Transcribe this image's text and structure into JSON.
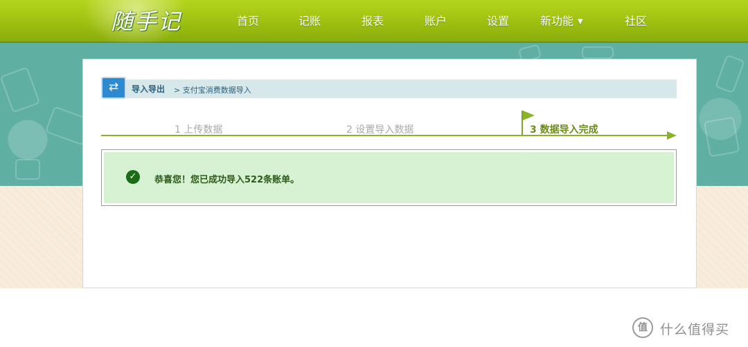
{
  "logo": {
    "text": "随手记"
  },
  "nav": {
    "items": [
      "首页",
      "记账",
      "报表",
      "账户",
      "设置",
      "新功能",
      "社区"
    ],
    "dropdown_caret": "▼"
  },
  "header": {
    "title": "导入导出",
    "breadcrumb": "> 支付宝消费数据导入",
    "icon": "import-export-icon"
  },
  "steps": [
    {
      "label": "1 上传数据",
      "state": "done"
    },
    {
      "label": "2 设置导入数据",
      "state": "done"
    },
    {
      "label": "3 数据导入完成",
      "state": "active"
    }
  ],
  "result": {
    "message": "恭喜您！您已成功导入522条账单。",
    "icon": "check-circle-icon",
    "color": "#1b6b17"
  },
  "watermark": {
    "text": "什么值得买",
    "icon_glyph": "值"
  },
  "colors": {
    "nav_green": "#a2c412",
    "teal": "#5fafa3",
    "accent_green": "#8ab32a",
    "success_bg": "#d7f2d3"
  }
}
